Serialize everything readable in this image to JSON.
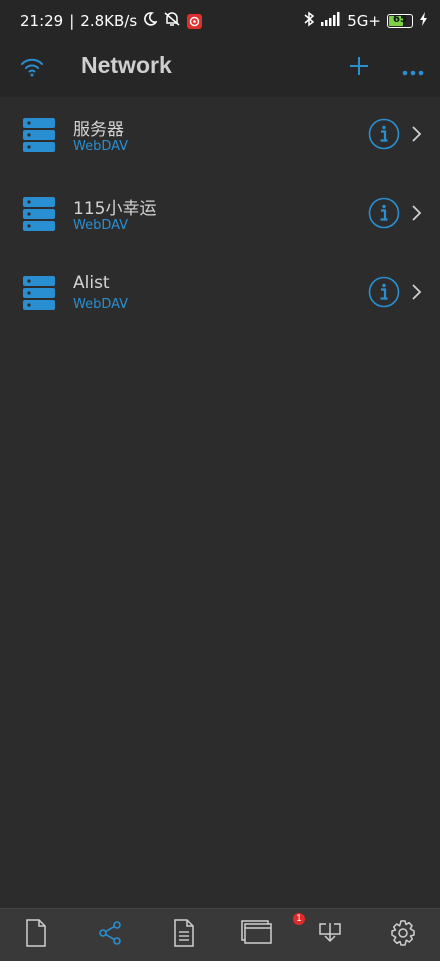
{
  "status_bar": {
    "time": "21:29",
    "separator": "|",
    "net_speed": "2.8KB/s",
    "network_type": "5G+",
    "battery_level": "65",
    "battery_percent": 65,
    "icons": [
      "moon-icon",
      "muted-vibrate-icon",
      "app-notification-icon",
      "bluetooth-icon",
      "signal-icon",
      "battery-icon",
      "charging-icon"
    ]
  },
  "header": {
    "title": "Network",
    "left_icon": "wifi-icon",
    "actions": [
      "add-icon",
      "more-icon"
    ]
  },
  "colors": {
    "accent": "#2a8fd0",
    "background": "#2c2c2c",
    "header_bg": "#262626",
    "tabbar_bg": "#393939",
    "badge": "#e12a2a",
    "battery": "#7bd147"
  },
  "connections": [
    {
      "name": "服务器",
      "type": "WebDAV",
      "icon": "server-icon"
    },
    {
      "name": "115小幸运",
      "type": "WebDAV",
      "icon": "server-icon"
    },
    {
      "name": "Alist",
      "type": "WebDAV",
      "icon": "server-icon"
    }
  ],
  "tabbar": {
    "tabs": [
      {
        "icon": "file-icon",
        "active": false
      },
      {
        "icon": "share-icon",
        "active": true
      },
      {
        "icon": "document-icon",
        "active": false
      },
      {
        "icon": "windows-icon",
        "active": false,
        "badge": "1"
      },
      {
        "icon": "download-icon",
        "active": false
      },
      {
        "icon": "settings-icon",
        "active": false
      }
    ]
  }
}
